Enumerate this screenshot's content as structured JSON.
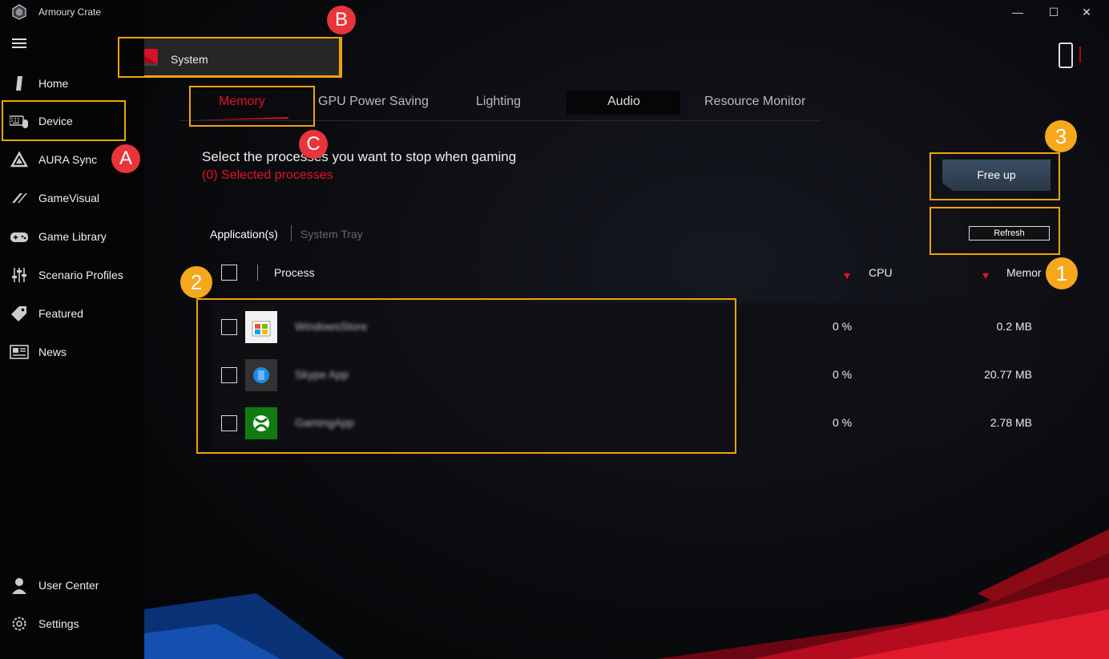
{
  "app": {
    "title": "Armoury Crate"
  },
  "sidebar": {
    "items": [
      {
        "label": "Home",
        "icon": "home-icon"
      },
      {
        "label": "Device",
        "icon": "keyboard-mouse-icon"
      },
      {
        "label": "AURA Sync",
        "icon": "aura-icon"
      },
      {
        "label": "GameVisual",
        "icon": "gamevisual-icon"
      },
      {
        "label": "Game Library",
        "icon": "gamepad-icon"
      },
      {
        "label": "Scenario Profiles",
        "icon": "sliders-icon"
      },
      {
        "label": "Featured",
        "icon": "tag-icon"
      },
      {
        "label": "News",
        "icon": "news-icon"
      }
    ],
    "bottom": [
      {
        "label": "User Center",
        "icon": "user-icon"
      },
      {
        "label": "Settings",
        "icon": "gear-icon"
      }
    ]
  },
  "window_controls": {
    "minimize": "—",
    "maximize": "☐",
    "close": "✕"
  },
  "device_selector": {
    "label": "System"
  },
  "tabs": [
    "Memory",
    "GPU Power Saving",
    "Lighting",
    "Audio",
    "Resource Monitor"
  ],
  "active_tab": "Memory",
  "memory": {
    "instruction": "Select the processes you want to stop when gaming",
    "selected": "(0) Selected processes",
    "free_up_label": "Free up",
    "refresh_label": "Refresh",
    "sub_tabs": [
      "Application(s)",
      "System Tray"
    ],
    "columns": {
      "process": "Process",
      "cpu": "CPU",
      "memory": "Memor"
    },
    "rows": [
      {
        "name": "WindowsStore",
        "cpu": "0 %",
        "memory": "0.2 MB",
        "icon": "store-icon"
      },
      {
        "name": "Skype App",
        "cpu": "0 %",
        "memory": "20.77 MB",
        "icon": "app-blue-icon"
      },
      {
        "name": "GamingApp",
        "cpu": "0 %",
        "memory": "2.78 MB",
        "icon": "xbox-icon"
      }
    ]
  },
  "annotations": {
    "A": "A",
    "B": "B",
    "C": "C",
    "n1": "1",
    "n2": "2",
    "n3": "3"
  },
  "colors": {
    "accent": "#e8102a",
    "highlight": "#f0a30a",
    "badge_orange": "#f5a81c",
    "badge_red": "#e8343a"
  }
}
